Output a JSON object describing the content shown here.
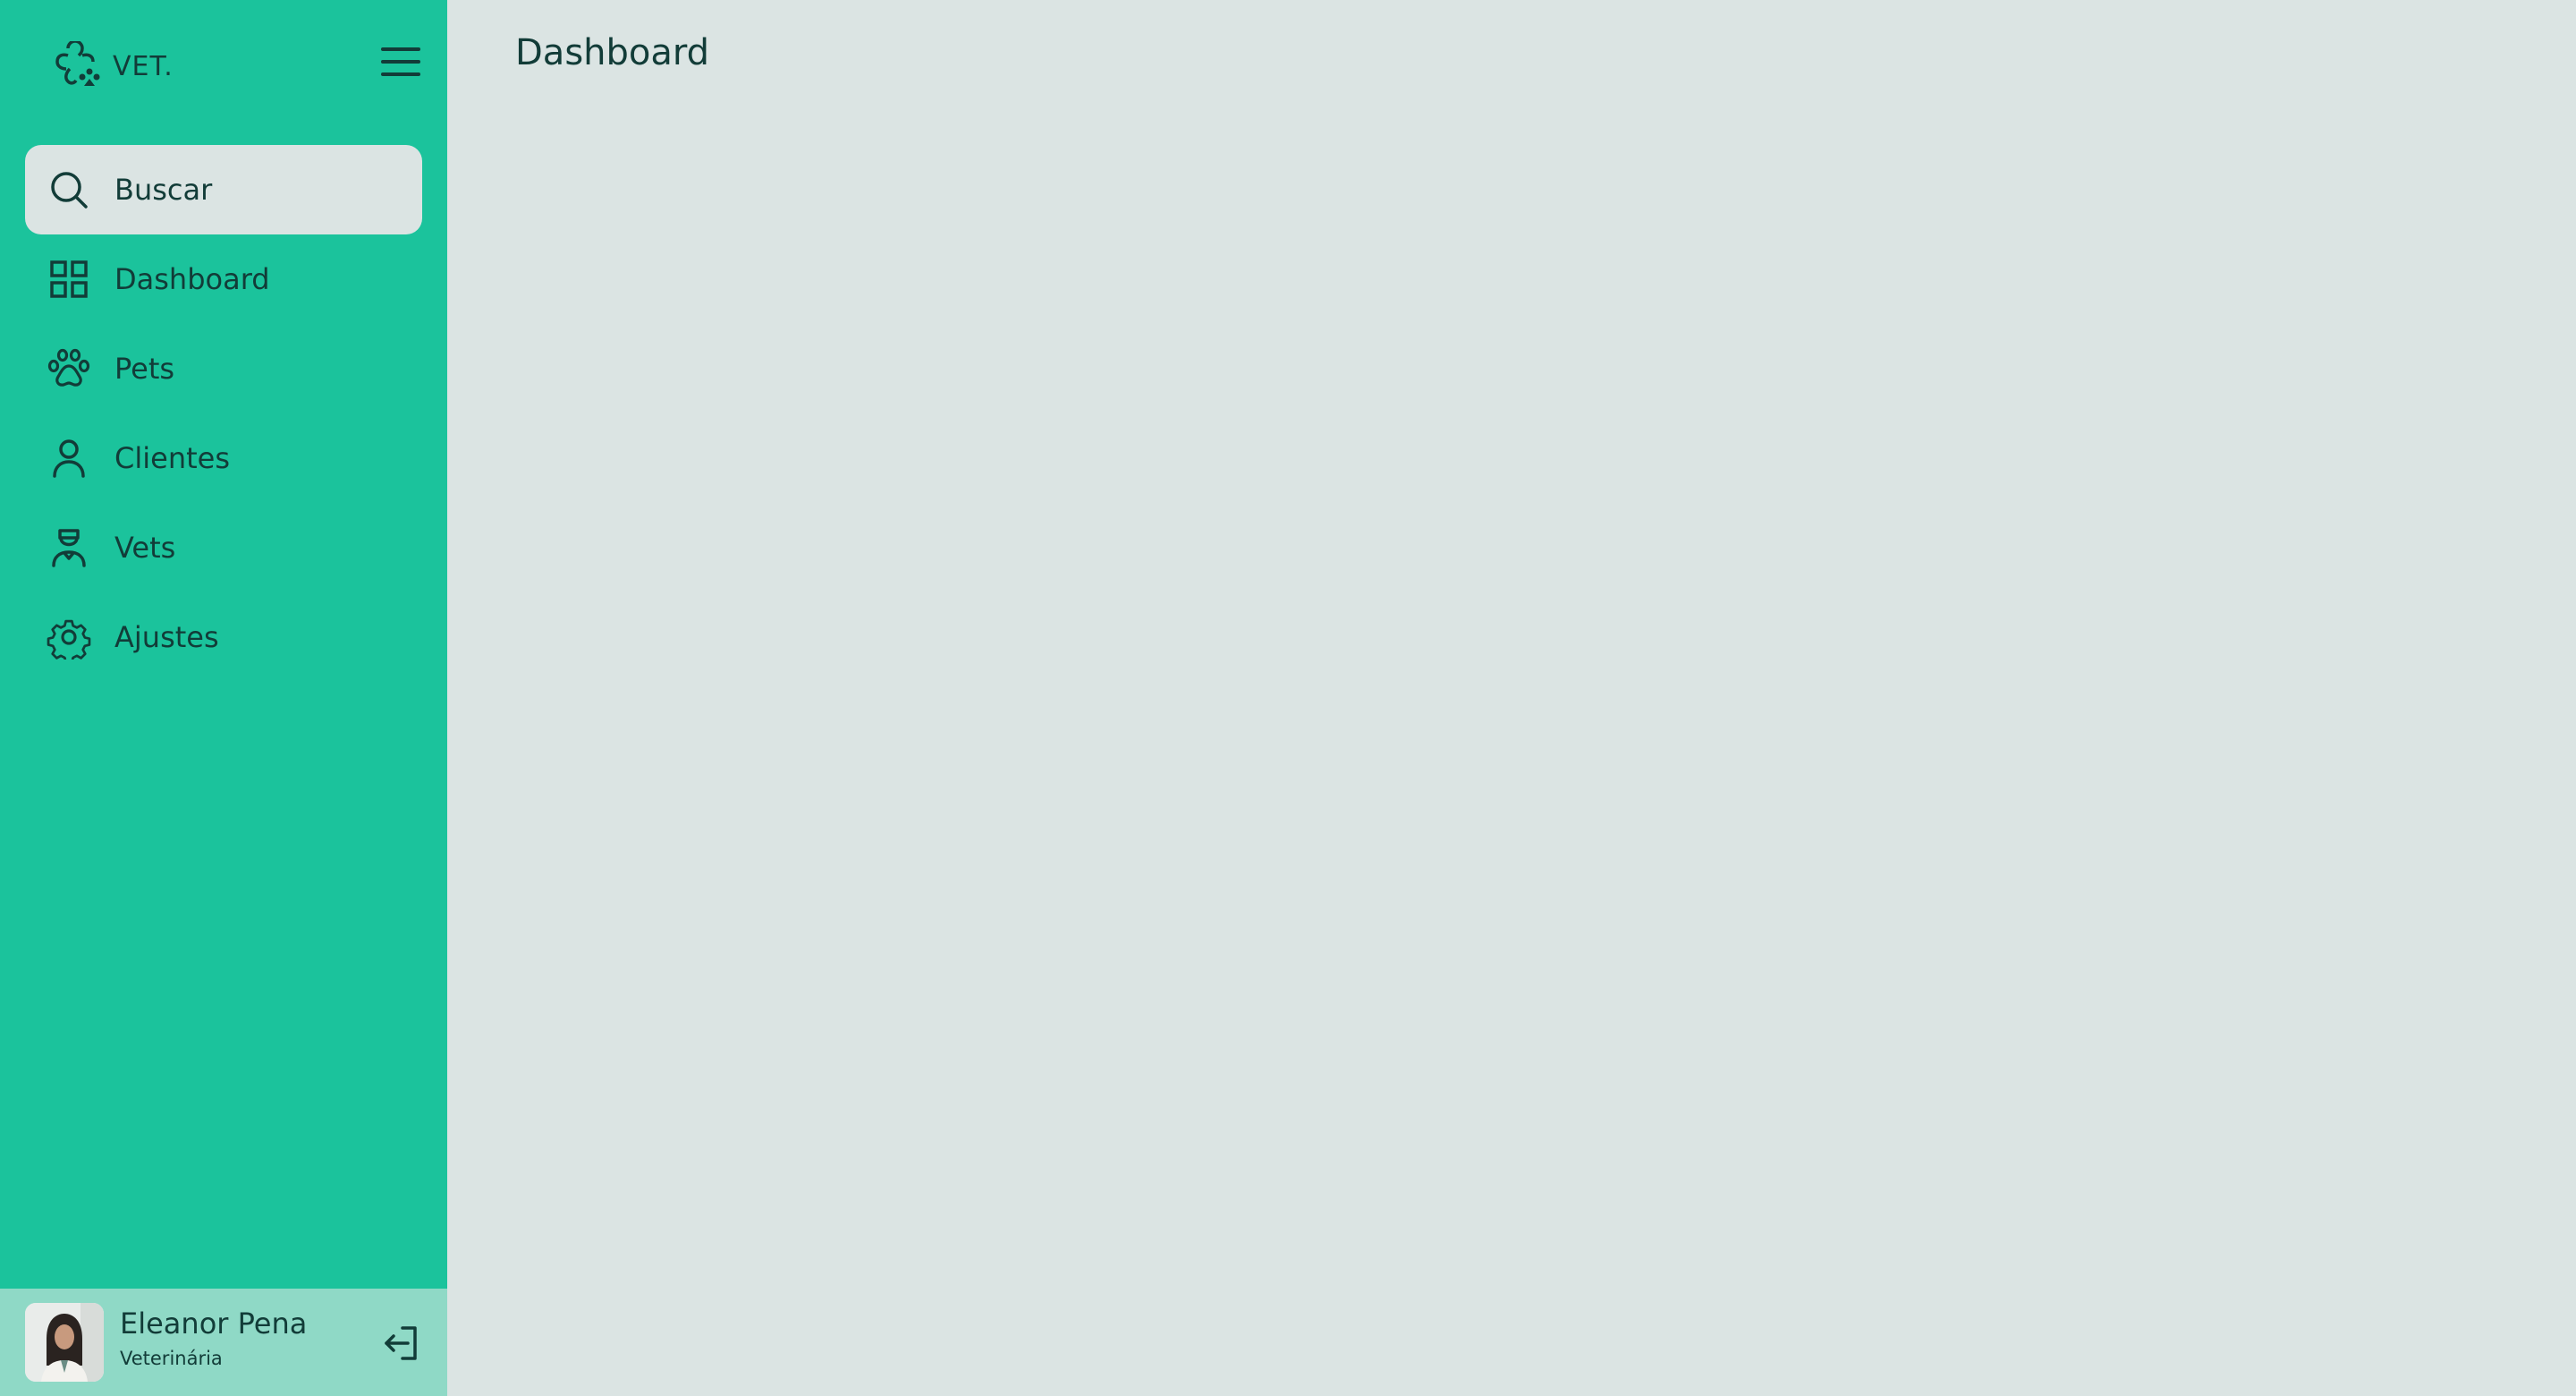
{
  "brand": {
    "name": "VET.",
    "icon": "paw-clover-logo"
  },
  "header": {
    "menu_icon": "hamburger-icon"
  },
  "sidebar": {
    "items": [
      {
        "label": "Buscar",
        "icon": "search-icon",
        "active": true
      },
      {
        "label": "Dashboard",
        "icon": "grid-icon",
        "active": false
      },
      {
        "label": "Pets",
        "icon": "paw-icon",
        "active": false
      },
      {
        "label": "Clientes",
        "icon": "user-icon",
        "active": false
      },
      {
        "label": "Vets",
        "icon": "vet-icon",
        "active": false
      },
      {
        "label": "Ajustes",
        "icon": "gear-icon",
        "active": false
      }
    ]
  },
  "user": {
    "name": "Eleanor Pena",
    "role": "Veterinária",
    "logout_icon": "logout-icon"
  },
  "main": {
    "title": "Dashboard"
  },
  "colors": {
    "sidebar": "#1bc39c",
    "user_bar": "#8fd9c6",
    "background": "#dbe4e3",
    "text": "#123c38"
  }
}
